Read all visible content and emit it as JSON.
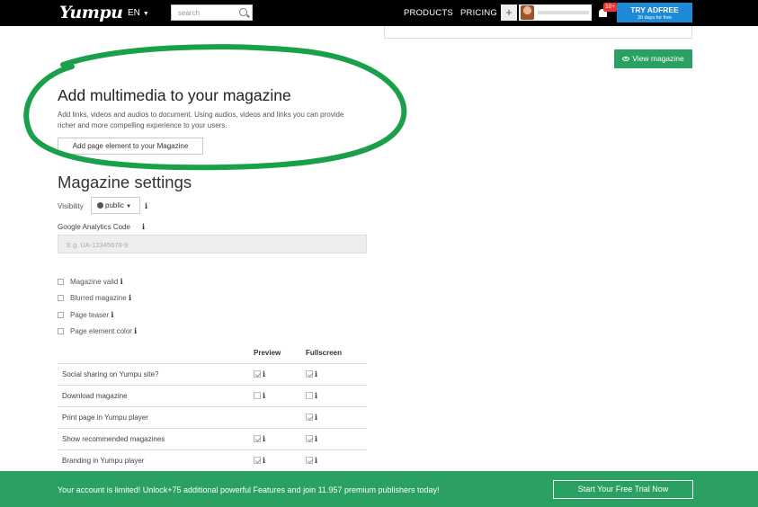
{
  "header": {
    "logo": "Yumpu",
    "lang": "EN",
    "search_placeholder": "search",
    "nav": [
      "PRODUCTS",
      "PRICING"
    ],
    "plus": "+",
    "notification_badge": "10+",
    "try_title": "TRY ADFREE",
    "try_sub": "30 days for free"
  },
  "top": {
    "view_magazine": "View magazine"
  },
  "multimedia": {
    "title": "Add multimedia to your magazine",
    "description": "Add links, videos and audios to document. Using audios, videos and links you can provide richer and more compelling experience to your users.",
    "button": "Add page element to your Magazine",
    "highlight_color": "#1aa04a"
  },
  "settings": {
    "title": "Magazine settings",
    "visibility_label": "Visibility",
    "visibility_value": "public",
    "ga_label": "Google Analytics Code",
    "ga_placeholder": "E.g. UA-12345678-9",
    "options": [
      "Magazine valid",
      "Blurred magazine",
      "Page teaser",
      "Page element color"
    ],
    "col_preview": "Preview",
    "col_fullscreen": "Fullscreen",
    "rows": [
      {
        "label": "Social sharing on Yumpu site?",
        "preview": true,
        "fullscreen": true
      },
      {
        "label": "Download magazine",
        "preview": false,
        "fullscreen": false
      },
      {
        "label": "Print page in Yumpu player",
        "preview": null,
        "fullscreen": true
      },
      {
        "label": "Show recommended magazines",
        "preview": true,
        "fullscreen": true
      },
      {
        "label": "Branding in Yumpu player",
        "preview": true,
        "fullscreen": true
      }
    ]
  },
  "banner": {
    "message": "Your account is limited! Unlock+75 additional powerful Features and join 11.957 premium publishers today!",
    "cta": "Start Your Free Trial Now",
    "color": "#2aa063"
  },
  "info_glyph": "i"
}
